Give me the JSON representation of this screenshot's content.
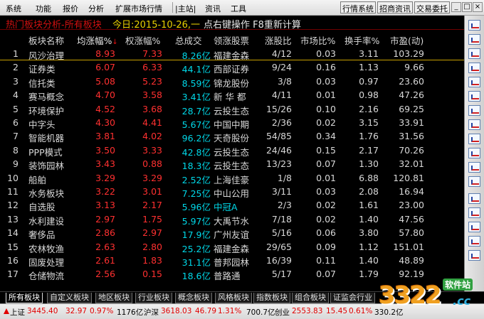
{
  "menubar": {
    "items": [
      "系统",
      "功能",
      "报价",
      "分析",
      "扩展市场行情",
      "|主站|",
      "资讯",
      "工具"
    ],
    "buttons": [
      "行情系统",
      "招商资讯",
      "交易委托"
    ],
    "window_controls": [
      "_",
      "□",
      "×"
    ]
  },
  "title": {
    "section": "热门板块分析-所有板块",
    "date": "今日:2015-10-26,一",
    "hint": "点右键操作 F8重新计算"
  },
  "table": {
    "headers": [
      "板块名称",
      "均涨幅%",
      "权涨幅%",
      "总成交",
      "领涨股票",
      "涨股比",
      "市场比%",
      "换手率%",
      "市盈(动)"
    ],
    "sort_marker": "↓",
    "rows": [
      {
        "idx": "1",
        "name": "风沙治理",
        "avg": "8.93",
        "wavg": "7.33",
        "turnover": "8.26亿",
        "leader": "福建金森",
        "leader_color": "white",
        "ratio": "4/12",
        "mkt": "0.03",
        "turn": "3.11",
        "pe": "103.29"
      },
      {
        "idx": "2",
        "name": "证券类",
        "avg": "6.07",
        "wavg": "6.33",
        "turnover": "44.1亿",
        "leader": "西部证券",
        "leader_color": "white",
        "ratio": "9/24",
        "mkt": "0.16",
        "turn": "1.13",
        "pe": "9.66"
      },
      {
        "idx": "3",
        "name": "信托类",
        "avg": "5.08",
        "wavg": "5.23",
        "turnover": "8.59亿",
        "leader": "锦龙股份",
        "leader_color": "white",
        "ratio": "3/8",
        "mkt": "0.03",
        "turn": "0.97",
        "pe": "23.60"
      },
      {
        "idx": "4",
        "name": "赛马概念",
        "avg": "4.70",
        "wavg": "3.58",
        "turnover": "3.41亿",
        "leader": "新 华 都",
        "leader_color": "white",
        "ratio": "4/11",
        "mkt": "0.01",
        "turn": "0.98",
        "pe": "47.26"
      },
      {
        "idx": "5",
        "name": "环境保护",
        "avg": "4.52",
        "wavg": "3.68",
        "turnover": "28.7亿",
        "leader": "云投生态",
        "leader_color": "white",
        "ratio": "15/26",
        "mkt": "0.10",
        "turn": "2.16",
        "pe": "69.25"
      },
      {
        "idx": "6",
        "name": "中字头",
        "avg": "4.30",
        "wavg": "4.41",
        "turnover": "5.67亿",
        "leader": "中国中期",
        "leader_color": "white",
        "ratio": "2/36",
        "mkt": "0.02",
        "turn": "3.15",
        "pe": "33.91"
      },
      {
        "idx": "7",
        "name": "智能机器",
        "avg": "3.81",
        "wavg": "4.02",
        "turnover": "96.2亿",
        "leader": "天奇股份",
        "leader_color": "white",
        "ratio": "54/85",
        "mkt": "0.34",
        "turn": "1.76",
        "pe": "31.56"
      },
      {
        "idx": "8",
        "name": "PPP模式",
        "avg": "3.50",
        "wavg": "3.33",
        "turnover": "42.8亿",
        "leader": "云投生态",
        "leader_color": "white",
        "ratio": "24/46",
        "mkt": "0.15",
        "turn": "2.17",
        "pe": "70.26"
      },
      {
        "idx": "9",
        "name": "装饰园林",
        "avg": "3.43",
        "wavg": "0.88",
        "turnover": "18.3亿",
        "leader": "云投生态",
        "leader_color": "white",
        "ratio": "13/23",
        "mkt": "0.07",
        "turn": "1.30",
        "pe": "32.01"
      },
      {
        "idx": "10",
        "name": "船舶",
        "avg": "3.29",
        "wavg": "3.29",
        "turnover": "2.52亿",
        "leader": "上海佳豪",
        "leader_color": "white",
        "ratio": "1/8",
        "mkt": "0.01",
        "turn": "6.88",
        "pe": "120.81"
      },
      {
        "idx": "11",
        "name": "水务板块",
        "avg": "3.22",
        "wavg": "3.01",
        "turnover": "7.25亿",
        "leader": "中山公用",
        "leader_color": "white",
        "ratio": "3/11",
        "mkt": "0.03",
        "turn": "2.08",
        "pe": "16.94"
      },
      {
        "idx": "12",
        "name": "自选股",
        "avg": "3.13",
        "wavg": "2.17",
        "turnover": "5.96亿",
        "leader": "中冠A",
        "leader_color": "cyan",
        "ratio": "2/3",
        "mkt": "0.02",
        "turn": "1.61",
        "pe": "23.00"
      },
      {
        "idx": "13",
        "name": "水利建设",
        "avg": "2.97",
        "wavg": "1.75",
        "turnover": "5.97亿",
        "leader": "大禹节水",
        "leader_color": "white",
        "ratio": "7/18",
        "mkt": "0.02",
        "turn": "1.40",
        "pe": "47.56"
      },
      {
        "idx": "14",
        "name": "奢侈品",
        "avg": "2.86",
        "wavg": "2.97",
        "turnover": "17.9亿",
        "leader": "广州友谊",
        "leader_color": "white",
        "ratio": "5/16",
        "mkt": "0.06",
        "turn": "3.80",
        "pe": "57.80"
      },
      {
        "idx": "15",
        "name": "农林牧渔",
        "avg": "2.63",
        "wavg": "2.80",
        "turnover": "25.2亿",
        "leader": "福建金森",
        "leader_color": "white",
        "ratio": "29/65",
        "mkt": "0.09",
        "turn": "1.12",
        "pe": "151.01"
      },
      {
        "idx": "16",
        "name": "固废处理",
        "avg": "2.61",
        "wavg": "1.83",
        "turnover": "31.1亿",
        "leader": "普邦园林",
        "leader_color": "white",
        "ratio": "16/39",
        "mkt": "0.11",
        "turn": "1.40",
        "pe": "48.89"
      },
      {
        "idx": "17",
        "name": "仓储物流",
        "avg": "2.56",
        "wavg": "0.15",
        "turnover": "18.6亿",
        "leader": "普路通",
        "leader_color": "white",
        "ratio": "5/17",
        "mkt": "0.07",
        "turn": "1.79",
        "pe": "92.19"
      }
    ]
  },
  "tabs": [
    "所有板块",
    "自定义板块",
    "地区板块",
    "行业板块",
    "概念板块",
    "风格板块",
    "指数板块",
    "组合板块",
    "证监会行业"
  ],
  "status": {
    "sh_label": "上证",
    "sh_value": "3445.40",
    "sh_change": "32.97",
    "sh_pct": "0.97%",
    "sh_volume": "1176亿",
    "sz_label": "沪深",
    "sz_value": "3618.03",
    "sz_change": "46.79",
    "sz_pct": "1.31%",
    "sz_volume": "700.7亿",
    "cy_label": "创业",
    "cy_value": "2553.83",
    "cy_change": "15.45",
    "cy_pct": "0.61%",
    "cy_volume": "330.2亿"
  },
  "watermark": {
    "number": "3322",
    "site": "软件站",
    "suffix": ".cc"
  },
  "colors": {
    "up": "#ff3030",
    "turnover": "#00d8e8",
    "title": "#d01010",
    "date": "#e8d000",
    "background": "#000000"
  }
}
